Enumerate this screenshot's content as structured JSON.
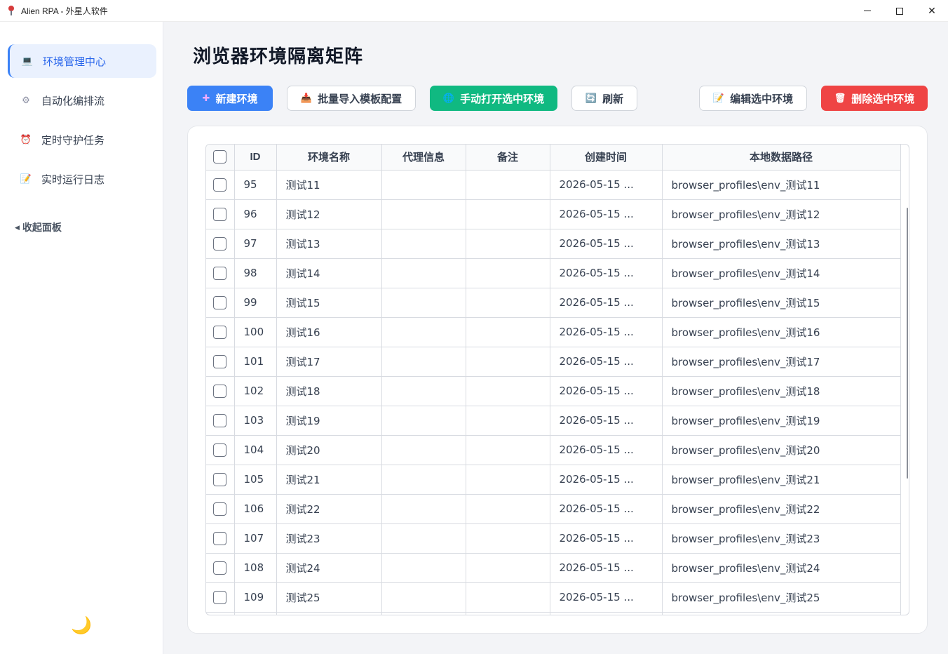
{
  "window": {
    "title": "Alien RPA - 外星人软件"
  },
  "sidebar": {
    "items": [
      {
        "label": "环境管理中心",
        "icon": "laptop-icon",
        "glyph": "💻",
        "active": true
      },
      {
        "label": "自动化编排流",
        "icon": "gear-icon",
        "glyph": "⚙",
        "active": false
      },
      {
        "label": "定时守护任务",
        "icon": "alarm-clock-icon",
        "glyph": "⏰",
        "active": false
      },
      {
        "label": "实时运行日志",
        "icon": "memo-icon",
        "glyph": "📝",
        "active": false
      }
    ],
    "collapse_label": "收起面板",
    "theme_toggle_glyph": "🌙"
  },
  "main": {
    "title": "浏览器环境隔离矩阵",
    "toolbar": {
      "new_env": "新建环境",
      "bulk_import": "批量导入模板配置",
      "open_selected": "手动打开选中环境",
      "refresh": "刷新",
      "edit_selected": "编辑选中环境",
      "delete_selected": "删除选中环境"
    },
    "table": {
      "columns": [
        "",
        "ID",
        "环境名称",
        "代理信息",
        "备注",
        "创建时间",
        "本地数据路径"
      ],
      "rows": [
        {
          "id": "95",
          "name": "测试11",
          "proxy": "",
          "note": "",
          "created": "2026-05-15 ...",
          "path": "browser_profiles\\env_测试11"
        },
        {
          "id": "96",
          "name": "测试12",
          "proxy": "",
          "note": "",
          "created": "2026-05-15 ...",
          "path": "browser_profiles\\env_测试12"
        },
        {
          "id": "97",
          "name": "测试13",
          "proxy": "",
          "note": "",
          "created": "2026-05-15 ...",
          "path": "browser_profiles\\env_测试13"
        },
        {
          "id": "98",
          "name": "测试14",
          "proxy": "",
          "note": "",
          "created": "2026-05-15 ...",
          "path": "browser_profiles\\env_测试14"
        },
        {
          "id": "99",
          "name": "测试15",
          "proxy": "",
          "note": "",
          "created": "2026-05-15 ...",
          "path": "browser_profiles\\env_测试15"
        },
        {
          "id": "100",
          "name": "测试16",
          "proxy": "",
          "note": "",
          "created": "2026-05-15 ...",
          "path": "browser_profiles\\env_测试16"
        },
        {
          "id": "101",
          "name": "测试17",
          "proxy": "",
          "note": "",
          "created": "2026-05-15 ...",
          "path": "browser_profiles\\env_测试17"
        },
        {
          "id": "102",
          "name": "测试18",
          "proxy": "",
          "note": "",
          "created": "2026-05-15 ...",
          "path": "browser_profiles\\env_测试18"
        },
        {
          "id": "103",
          "name": "测试19",
          "proxy": "",
          "note": "",
          "created": "2026-05-15 ...",
          "path": "browser_profiles\\env_测试19"
        },
        {
          "id": "104",
          "name": "测试20",
          "proxy": "",
          "note": "",
          "created": "2026-05-15 ...",
          "path": "browser_profiles\\env_测试20"
        },
        {
          "id": "105",
          "name": "测试21",
          "proxy": "",
          "note": "",
          "created": "2026-05-15 ...",
          "path": "browser_profiles\\env_测试21"
        },
        {
          "id": "106",
          "name": "测试22",
          "proxy": "",
          "note": "",
          "created": "2026-05-15 ...",
          "path": "browser_profiles\\env_测试22"
        },
        {
          "id": "107",
          "name": "测试23",
          "proxy": "",
          "note": "",
          "created": "2026-05-15 ...",
          "path": "browser_profiles\\env_测试23"
        },
        {
          "id": "108",
          "name": "测试24",
          "proxy": "",
          "note": "",
          "created": "2026-05-15 ...",
          "path": "browser_profiles\\env_测试24"
        },
        {
          "id": "109",
          "name": "测试25",
          "proxy": "",
          "note": "",
          "created": "2026-05-15 ...",
          "path": "browser_profiles\\env_测试25"
        }
      ]
    }
  },
  "colors": {
    "accent": "#3b82f6",
    "success": "#10b981",
    "danger": "#ef4444",
    "active_nav_bg": "#eaf1fe"
  }
}
